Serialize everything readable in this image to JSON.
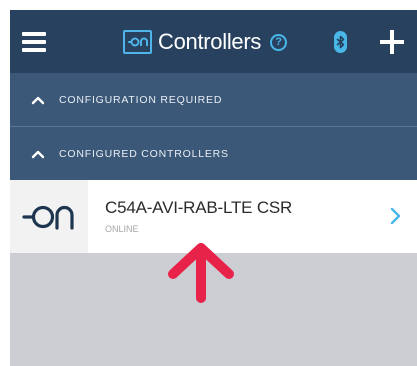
{
  "header": {
    "title": "Controllers",
    "help_glyph": "?",
    "icons": [
      "menu-icon",
      "on-logo-icon",
      "help-icon",
      "bluetooth-icon",
      "plus-icon"
    ],
    "colors": {
      "background": "#27415e",
      "accent": "#49b7e8"
    }
  },
  "sections": [
    {
      "label": "CONFIGURATION REQUIRED",
      "expanded": true
    },
    {
      "label": "CONFIGURED CONTROLLERS",
      "expanded": true
    }
  ],
  "controllers": [
    {
      "name": "C54A-AVI-RAB-LTE CSR",
      "status": "ONLINE",
      "icon": "on-logo-icon"
    }
  ],
  "annotation": {
    "icon": "arrow-up-icon",
    "color": "#e8234a"
  }
}
